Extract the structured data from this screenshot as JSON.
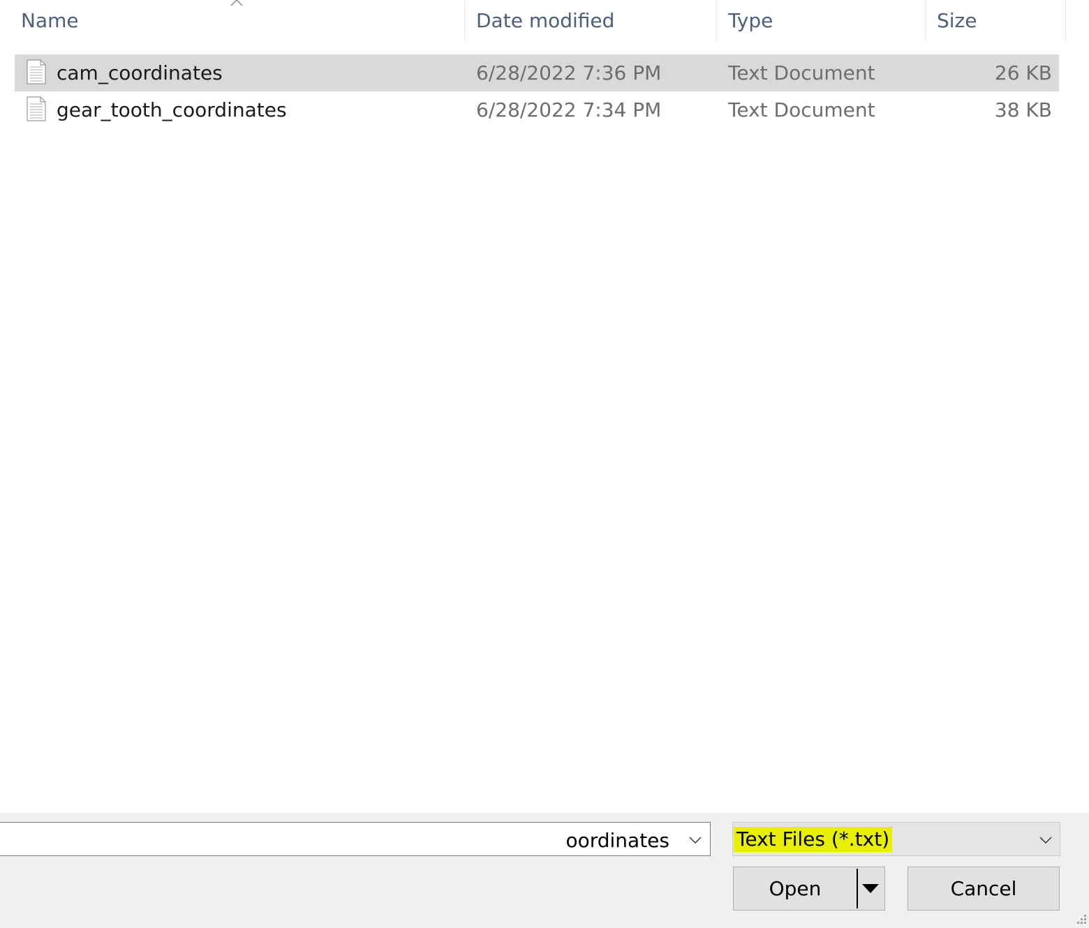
{
  "columns": {
    "name": "Name",
    "date_modified": "Date modified",
    "type": "Type",
    "size": "Size"
  },
  "sort": {
    "column": "Name",
    "direction": "ascending-indicator"
  },
  "files": [
    {
      "name": "cam_coordinates",
      "date_modified": "6/28/2022 7:36 PM",
      "type": "Text Document",
      "size": "26 KB",
      "selected": true,
      "icon": "text-file-icon"
    },
    {
      "name": "gear_tooth_coordinates",
      "date_modified": "6/28/2022 7:34 PM",
      "type": "Text Document",
      "size": "38 KB",
      "selected": false,
      "icon": "text-file-icon"
    }
  ],
  "footer": {
    "filename_value": "oordinates",
    "file_type_filter": "Text Files (*.txt)",
    "open_label": "Open",
    "cancel_label": "Cancel"
  },
  "colors": {
    "selection": "#d9d9d9",
    "filter_highlight": "#e8ef00",
    "header_text": "#4c607a",
    "panel_bg": "#f0f0f0"
  }
}
